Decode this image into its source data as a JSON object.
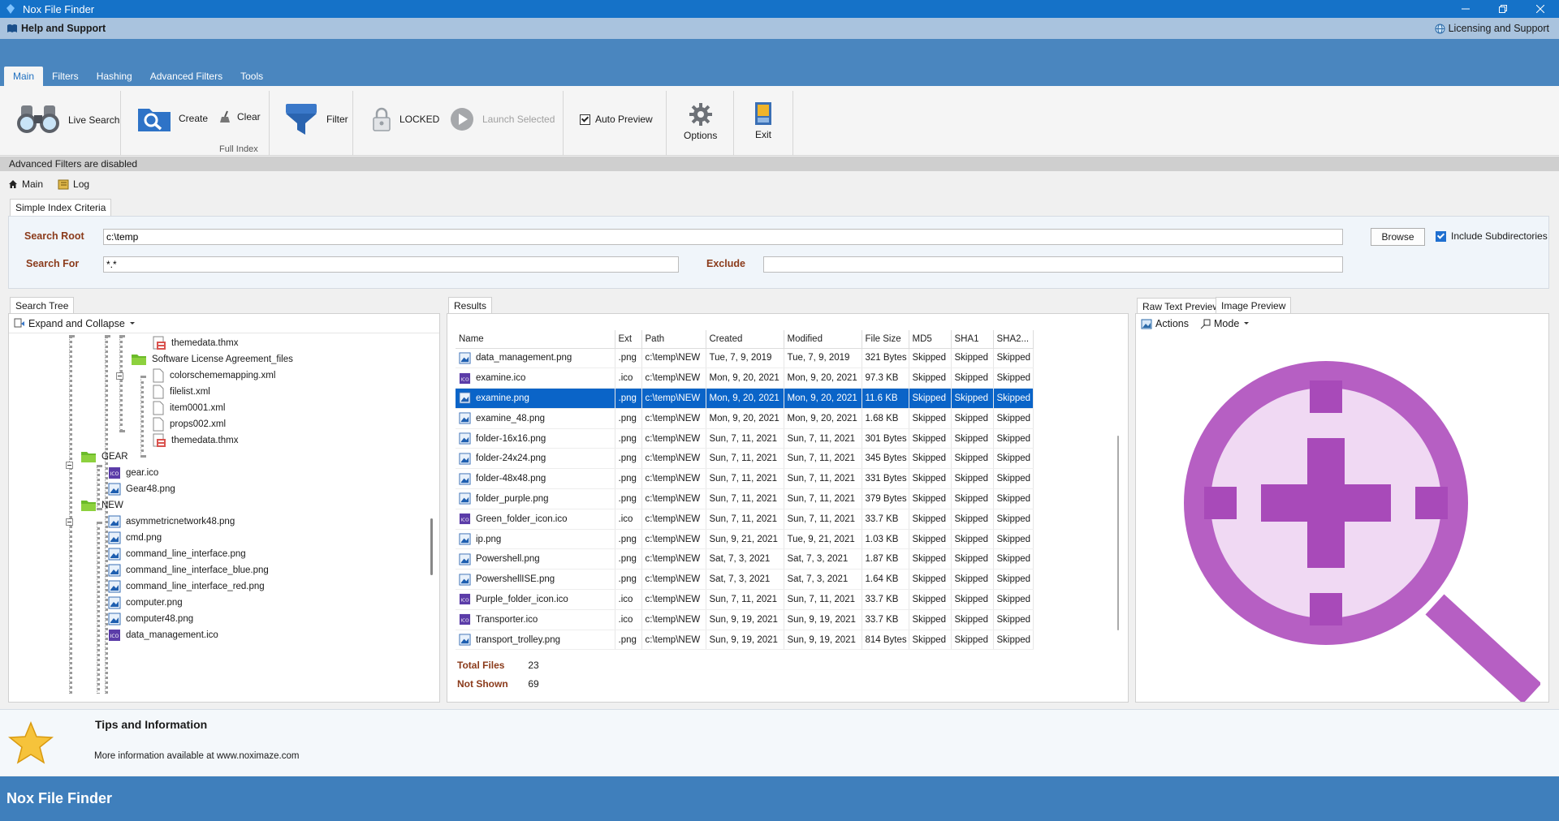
{
  "window": {
    "title": "Nox File Finder"
  },
  "help_bar": {
    "left": "Help and Support",
    "right": "Licensing and Support"
  },
  "ribbon": {
    "tabs": [
      {
        "label": "Main",
        "active": true
      },
      {
        "label": "Filters"
      },
      {
        "label": "Hashing"
      },
      {
        "label": "Advanced Filters"
      },
      {
        "label": "Tools"
      }
    ],
    "live_search": "Live Search",
    "create": "Create",
    "clear": "Clear",
    "full_index": "Full Index",
    "filter": "Filter",
    "locked": "LOCKED",
    "launch_selected": "Launch Selected",
    "auto_preview": "Auto Preview",
    "options": "Options",
    "exit": "Exit"
  },
  "status": "Advanced Filters are disabled",
  "doc_tabs": {
    "main": "Main",
    "log": "Log"
  },
  "criteria": {
    "tab": "Simple Index Criteria",
    "search_root_label": "Search Root",
    "search_root_value": "c:\\temp",
    "search_for_label": "Search For",
    "search_for_value": "*.*",
    "exclude_label": "Exclude",
    "exclude_value": "",
    "browse": "Browse",
    "include_subdirs": "Include Subdirectories"
  },
  "tree": {
    "tab": "Search Tree",
    "toolbar": "Expand and Collapse",
    "nodes": [
      {
        "label": "themedata.thmx"
      },
      {
        "label": "Software License Agreement_files"
      },
      {
        "label": "colorschememapping.xml"
      },
      {
        "label": "filelist.xml"
      },
      {
        "label": "item0001.xml"
      },
      {
        "label": "props002.xml"
      },
      {
        "label": "themedata.thmx"
      },
      {
        "label": "GEAR"
      },
      {
        "label": "gear.ico"
      },
      {
        "label": "Gear48.png"
      },
      {
        "label": "NEW"
      },
      {
        "label": "asymmetricnetwork48.png"
      },
      {
        "label": "cmd.png"
      },
      {
        "label": "command_line_interface.png"
      },
      {
        "label": "command_line_interface_blue.png"
      },
      {
        "label": "command_line_interface_red.png"
      },
      {
        "label": "computer.png"
      },
      {
        "label": "computer48.png"
      },
      {
        "label": "data_management.ico"
      }
    ]
  },
  "results": {
    "tab": "Results",
    "columns": [
      "Name",
      "Ext",
      "Path",
      "Created",
      "Modified",
      "File Size",
      "MD5",
      "SHA1",
      "SHA2..."
    ],
    "rows": [
      {
        "name": "data_management.png",
        "ext": ".png",
        "path": "c:\\temp\\NEW",
        "created": "Tue, 7, 9, 2019",
        "modified": "Tue, 7, 9, 2019",
        "size": "321 Bytes",
        "md5": "Skipped",
        "sha1": "Skipped",
        "sha2": "Skipped",
        "icon": "png"
      },
      {
        "name": "examine.ico",
        "ext": ".ico",
        "path": "c:\\temp\\NEW",
        "created": "Mon, 9, 20, 2021",
        "modified": "Mon, 9, 20, 2021",
        "size": "97.3 KB",
        "md5": "Skipped",
        "sha1": "Skipped",
        "sha2": "Skipped",
        "icon": "ico"
      },
      {
        "name": "examine.png",
        "ext": ".png",
        "path": "c:\\temp\\NEW",
        "created": "Mon, 9, 20, 2021",
        "modified": "Mon, 9, 20, 2021",
        "size": "11.6 KB",
        "md5": "Skipped",
        "sha1": "Skipped",
        "sha2": "Skipped",
        "icon": "png",
        "selected": true
      },
      {
        "name": "examine_48.png",
        "ext": ".png",
        "path": "c:\\temp\\NEW",
        "created": "Mon, 9, 20, 2021",
        "modified": "Mon, 9, 20, 2021",
        "size": "1.68 KB",
        "md5": "Skipped",
        "sha1": "Skipped",
        "sha2": "Skipped",
        "icon": "png"
      },
      {
        "name": "folder-16x16.png",
        "ext": ".png",
        "path": "c:\\temp\\NEW",
        "created": "Sun, 7, 11, 2021",
        "modified": "Sun, 7, 11, 2021",
        "size": "301 Bytes",
        "md5": "Skipped",
        "sha1": "Skipped",
        "sha2": "Skipped",
        "icon": "png"
      },
      {
        "name": "folder-24x24.png",
        "ext": ".png",
        "path": "c:\\temp\\NEW",
        "created": "Sun, 7, 11, 2021",
        "modified": "Sun, 7, 11, 2021",
        "size": "345 Bytes",
        "md5": "Skipped",
        "sha1": "Skipped",
        "sha2": "Skipped",
        "icon": "png"
      },
      {
        "name": "folder-48x48.png",
        "ext": ".png",
        "path": "c:\\temp\\NEW",
        "created": "Sun, 7, 11, 2021",
        "modified": "Sun, 7, 11, 2021",
        "size": "331 Bytes",
        "md5": "Skipped",
        "sha1": "Skipped",
        "sha2": "Skipped",
        "icon": "png"
      },
      {
        "name": "folder_purple.png",
        "ext": ".png",
        "path": "c:\\temp\\NEW",
        "created": "Sun, 7, 11, 2021",
        "modified": "Sun, 7, 11, 2021",
        "size": "379 Bytes",
        "md5": "Skipped",
        "sha1": "Skipped",
        "sha2": "Skipped",
        "icon": "png"
      },
      {
        "name": "Green_folder_icon.ico",
        "ext": ".ico",
        "path": "c:\\temp\\NEW",
        "created": "Sun, 7, 11, 2021",
        "modified": "Sun, 7, 11, 2021",
        "size": "33.7 KB",
        "md5": "Skipped",
        "sha1": "Skipped",
        "sha2": "Skipped",
        "icon": "ico"
      },
      {
        "name": "ip.png",
        "ext": ".png",
        "path": "c:\\temp\\NEW",
        "created": "Sun, 9, 21, 2021",
        "modified": "Tue, 9, 21, 2021",
        "size": "1.03 KB",
        "md5": "Skipped",
        "sha1": "Skipped",
        "sha2": "Skipped",
        "icon": "png"
      },
      {
        "name": "Powershell.png",
        "ext": ".png",
        "path": "c:\\temp\\NEW",
        "created": "Sat, 7, 3, 2021",
        "modified": "Sat, 7, 3, 2021",
        "size": "1.87 KB",
        "md5": "Skipped",
        "sha1": "Skipped",
        "sha2": "Skipped",
        "icon": "png"
      },
      {
        "name": "PowershellISE.png",
        "ext": ".png",
        "path": "c:\\temp\\NEW",
        "created": "Sat, 7, 3, 2021",
        "modified": "Sat, 7, 3, 2021",
        "size": "1.64 KB",
        "md5": "Skipped",
        "sha1": "Skipped",
        "sha2": "Skipped",
        "icon": "png"
      },
      {
        "name": "Purple_folder_icon.ico",
        "ext": ".ico",
        "path": "c:\\temp\\NEW",
        "created": "Sun, 7, 11, 2021",
        "modified": "Sun, 7, 11, 2021",
        "size": "33.7 KB",
        "md5": "Skipped",
        "sha1": "Skipped",
        "sha2": "Skipped",
        "icon": "ico"
      },
      {
        "name": "Transporter.ico",
        "ext": ".ico",
        "path": "c:\\temp\\NEW",
        "created": "Sun, 9, 19, 2021",
        "modified": "Sun, 9, 19, 2021",
        "size": "33.7 KB",
        "md5": "Skipped",
        "sha1": "Skipped",
        "sha2": "Skipped",
        "icon": "ico"
      },
      {
        "name": "transport_trolley.png",
        "ext": ".png",
        "path": "c:\\temp\\NEW",
        "created": "Sun, 9, 19, 2021",
        "modified": "Sun, 9, 19, 2021",
        "size": "814 Bytes",
        "md5": "Skipped",
        "sha1": "Skipped",
        "sha2": "Skipped",
        "icon": "png"
      }
    ],
    "total_files_label": "Total Files",
    "total_files": "23",
    "not_shown_label": "Not Shown",
    "not_shown": "69"
  },
  "preview": {
    "tab_raw": "Raw Text Preview",
    "tab_image": "Image Preview",
    "actions": "Actions",
    "mode": "Mode",
    "image_icon": "magnifier-plus-icon"
  },
  "tips": {
    "title": "Tips and Information",
    "body": "More information available at www.noximaze.com"
  },
  "footer": "Nox File Finder",
  "colors": {
    "title_bar": "#1572c8",
    "ribbon_band": "#4a86bf",
    "footer": "#3f7fbc",
    "selection": "#0a64c8",
    "label_brown": "#8b3b1b",
    "preview_purple": "#b65fc3"
  }
}
